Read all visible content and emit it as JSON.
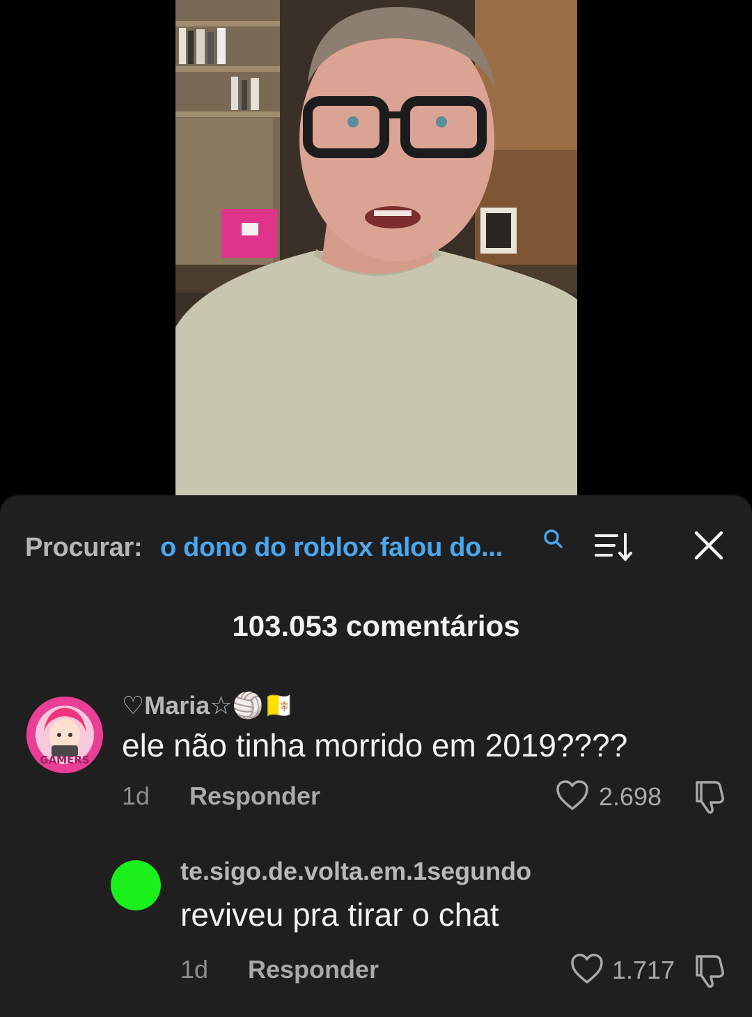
{
  "search": {
    "prefix": "Procurar:",
    "query": "o dono do roblox falou do..."
  },
  "comments_header": {
    "count_label": "103.053 comentários"
  },
  "comments": [
    {
      "username": "♡Maria☆🏐🇻🇦",
      "text": "ele não tinha morrido em 2019????",
      "time": "1d",
      "reply_label": "Responder",
      "likes": "2.698",
      "avatar_badge": "GAMERS"
    },
    {
      "username": "te.sigo.de.volta.em.1segundo",
      "text": "reviveu pra tirar o chat",
      "time": "1d",
      "reply_label": "Responder",
      "likes": "1.717",
      "avatar_color": "#19f01c"
    }
  ],
  "icons": {
    "search": "search-icon",
    "sort": "sort-icon",
    "close": "close-icon",
    "like": "heart-icon",
    "dislike": "thumbs-down-icon"
  },
  "colors": {
    "sheet_bg": "#1f1f1f",
    "query_text": "#4aa6ee",
    "accent_green": "#19f01c"
  }
}
